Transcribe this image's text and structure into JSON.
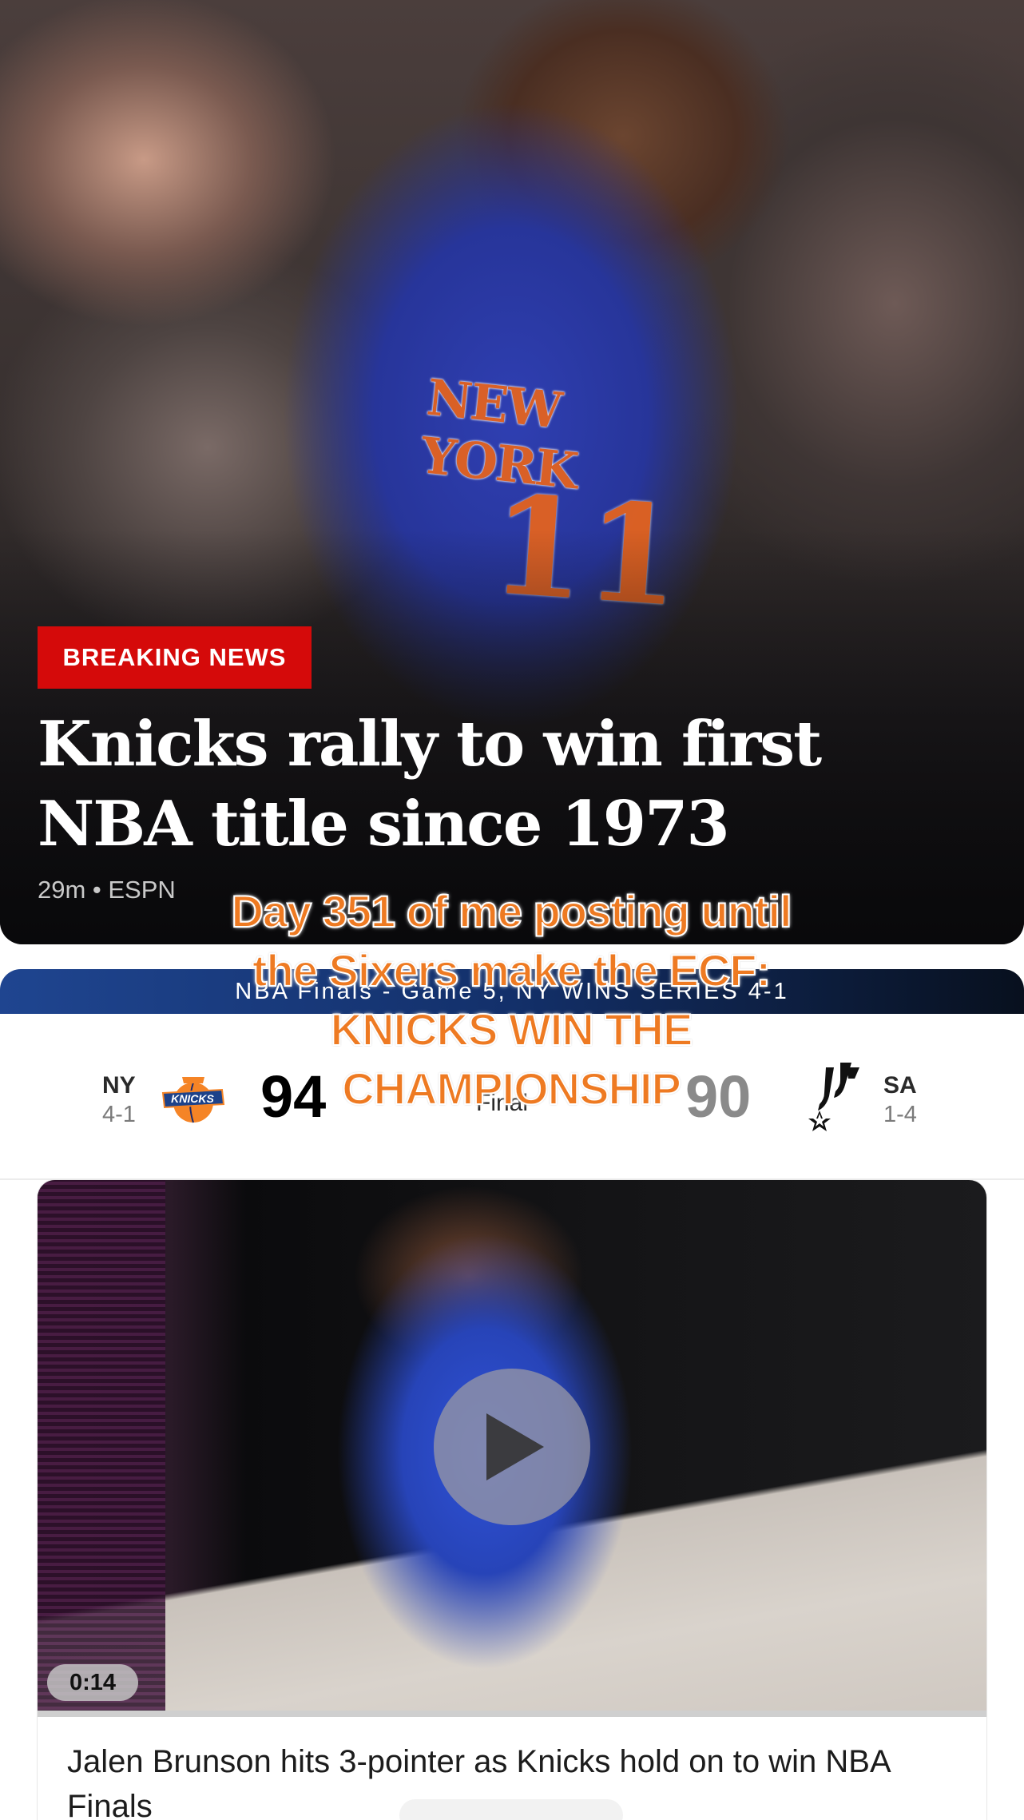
{
  "hero": {
    "badge": "BREAKING NEWS",
    "headline": "Knicks rally to win first NBA title since 1973",
    "meta": "29m • ESPN",
    "jersey_text": "NEW YORK",
    "jersey_number": "11",
    "image_subject": "Knicks player in #11 New York jersey gesturing"
  },
  "score": {
    "banner": "NBA Finals - Game 5, NY WINS SERIES 4-1",
    "status": "Final",
    "home": {
      "abbr": "NY",
      "record": "4-1",
      "score": "94",
      "logo": "knicks-logo",
      "score_color": "#2a2a2a"
    },
    "away": {
      "abbr": "SA",
      "record": "1-4",
      "score": "90",
      "logo": "spurs-logo",
      "score_color": "#8a8a8a"
    }
  },
  "video": {
    "duration": "0:14",
    "title": "Jalen Brunson hits 3-pointer as Knicks hold on to win NBA Finals",
    "play_icon": "play-icon"
  },
  "overlay": {
    "lines": [
      "Day 351 of me posting until",
      "the Sixers make the ECF:",
      "KNICKS WIN THE",
      "CHAMPIONSHIP"
    ],
    "color": "#ee7a22"
  },
  "colors": {
    "breaking_red": "#d50a0a",
    "banner_blue": "#1f4590"
  }
}
